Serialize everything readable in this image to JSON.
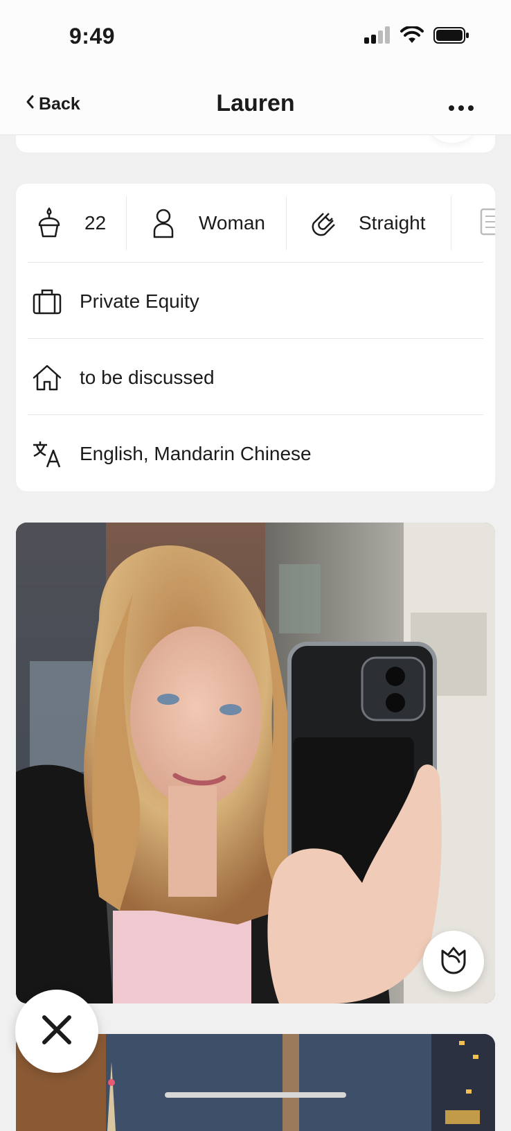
{
  "status_bar": {
    "time": "9:49",
    "signal_icon": "cellular-signal-icon",
    "wifi_icon": "wifi-icon",
    "battery_icon": "battery-icon"
  },
  "nav": {
    "back_label": "Back",
    "title": "Lauren",
    "more_icon": "more-horizontal-icon"
  },
  "profile_info": {
    "chips": [
      {
        "icon": "birthday-cake-icon",
        "value": "22"
      },
      {
        "icon": "person-icon",
        "value": "Woman"
      },
      {
        "icon": "magnet-icon",
        "value": "Straight"
      },
      {
        "icon": "document-icon",
        "value": ""
      }
    ],
    "rows": [
      {
        "icon": "briefcase-icon",
        "value": "Private Equity"
      },
      {
        "icon": "home-icon",
        "value": "to be discussed"
      },
      {
        "icon": "translate-icon",
        "value": "English, Mandarin Chinese"
      }
    ]
  },
  "actions": {
    "rose_icon": "rose-icon",
    "skip_icon": "close-x-icon"
  },
  "colors": {
    "background": "#f0f0f0",
    "card": "#ffffff",
    "text": "#1b1b1b"
  }
}
